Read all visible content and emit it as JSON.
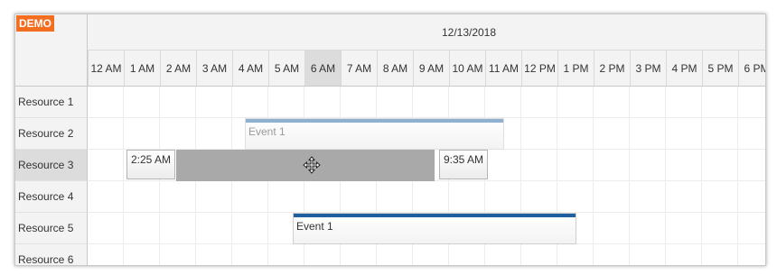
{
  "badge": "DEMO",
  "date_header": "12/13/2018",
  "hours": [
    "12 AM",
    "1 AM",
    "2 AM",
    "3 AM",
    "4 AM",
    "5 AM",
    "6 AM",
    "7 AM",
    "8 AM",
    "9 AM",
    "10 AM",
    "11 AM",
    "12 PM",
    "1 PM",
    "2 PM",
    "3 PM",
    "4 PM",
    "5 PM",
    "6 PM"
  ],
  "highlighted_hour": "6 AM",
  "resources": [
    "Resource 1",
    "Resource 2",
    "Resource 3",
    "Resource 4",
    "Resource 5",
    "Resource 6"
  ],
  "selected_resource": "Resource 3",
  "events": [
    {
      "name": "Event 1",
      "resource": "Resource 2",
      "state": "original-ghost",
      "bar_color": "#8fb0cf"
    },
    {
      "name": "Event 1",
      "resource": "Resource 5",
      "state": "normal",
      "bar_color": "#1f5fa0"
    }
  ],
  "drag": {
    "resource": "Resource 3",
    "start_label": "2:25 AM",
    "end_label": "9:35 AM",
    "icon": "move-icon"
  },
  "colors": {
    "badge": "#f36e21",
    "shadow": "#a9a9a9"
  }
}
